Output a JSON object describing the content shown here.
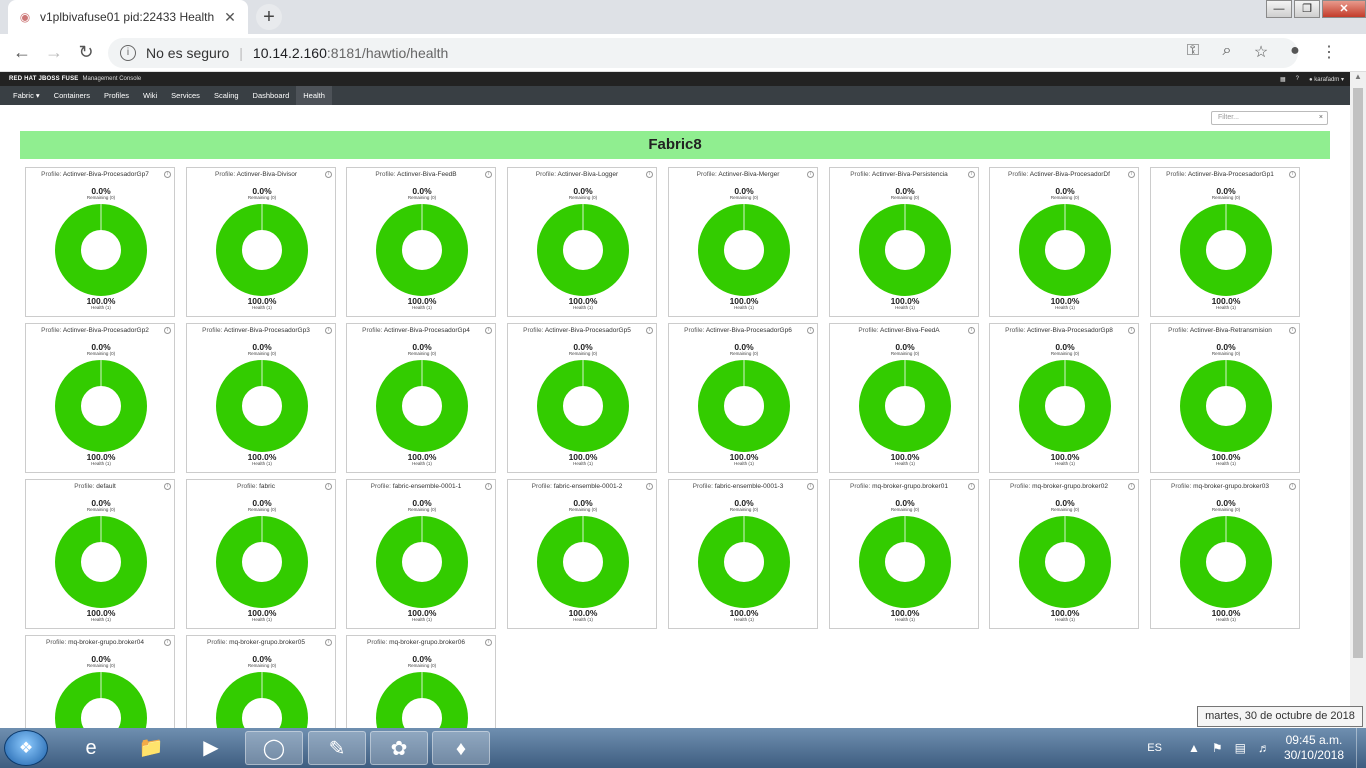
{
  "browser": {
    "tab_title": "v1plbivafuse01 pid:22433 Health",
    "security_label": "No es seguro",
    "url_host": "10.14.2.160",
    "url_rest": ":8181/hawtio/health",
    "colors": {
      "tab_strip": "#dee1e6",
      "omnibox": "#f1f3f4"
    }
  },
  "app": {
    "brand_primary": "RED HAT JBOSS FUSE",
    "brand_secondary": "Management Console",
    "user": "karafadm",
    "nav": [
      {
        "label": "Fabric"
      },
      {
        "label": "Containers"
      },
      {
        "label": "Profiles"
      },
      {
        "label": "Wiki"
      },
      {
        "label": "Services"
      },
      {
        "label": "Scaling"
      },
      {
        "label": "Dashboard"
      },
      {
        "label": "Health"
      }
    ],
    "active_nav": "Health"
  },
  "health": {
    "filter_placeholder": "Filter...",
    "banner_title": "Fabric8",
    "banner_color": "#90ee90",
    "donut_color": "#33cc00",
    "profile_prefix": "Profile:",
    "remaining_label": "Remaining (0)",
    "health_label": "Health (1)",
    "profiles": [
      {
        "name": "Actinver-Biva-ProcesadorGp7",
        "remaining": "0.0%",
        "health": "100.0%"
      },
      {
        "name": "Actinver-Biva-Divisor",
        "remaining": "0.0%",
        "health": "100.0%"
      },
      {
        "name": "Actinver-Biva-FeedB",
        "remaining": "0.0%",
        "health": "100.0%"
      },
      {
        "name": "Actinver-Biva-Logger",
        "remaining": "0.0%",
        "health": "100.0%"
      },
      {
        "name": "Actinver-Biva-Merger",
        "remaining": "0.0%",
        "health": "100.0%"
      },
      {
        "name": "Actinver-Biva-Persistencia",
        "remaining": "0.0%",
        "health": "100.0%"
      },
      {
        "name": "Actinver-Biva-ProcesadorDf",
        "remaining": "0.0%",
        "health": "100.0%"
      },
      {
        "name": "Actinver-Biva-ProcesadorGp1",
        "remaining": "0.0%",
        "health": "100.0%"
      },
      {
        "name": "Actinver-Biva-ProcesadorGp2",
        "remaining": "0.0%",
        "health": "100.0%"
      },
      {
        "name": "Actinver-Biva-ProcesadorGp3",
        "remaining": "0.0%",
        "health": "100.0%"
      },
      {
        "name": "Actinver-Biva-ProcesadorGp4",
        "remaining": "0.0%",
        "health": "100.0%"
      },
      {
        "name": "Actinver-Biva-ProcesadorGp5",
        "remaining": "0.0%",
        "health": "100.0%"
      },
      {
        "name": "Actinver-Biva-ProcesadorGp6",
        "remaining": "0.0%",
        "health": "100.0%"
      },
      {
        "name": "Actinver-Biva-FeedA",
        "remaining": "0.0%",
        "health": "100.0%"
      },
      {
        "name": "Actinver-Biva-ProcesadorGp8",
        "remaining": "0.0%",
        "health": "100.0%"
      },
      {
        "name": "Actinver-Biva-Retransmision",
        "remaining": "0.0%",
        "health": "100.0%"
      },
      {
        "name": "default",
        "remaining": "0.0%",
        "health": "100.0%"
      },
      {
        "name": "fabric",
        "remaining": "0.0%",
        "health": "100.0%"
      },
      {
        "name": "fabric-ensemble-0001-1",
        "remaining": "0.0%",
        "health": "100.0%"
      },
      {
        "name": "fabric-ensemble-0001-2",
        "remaining": "0.0%",
        "health": "100.0%"
      },
      {
        "name": "fabric-ensemble-0001-3",
        "remaining": "0.0%",
        "health": "100.0%"
      },
      {
        "name": "mq-broker-grupo.broker01",
        "remaining": "0.0%",
        "health": "100.0%"
      },
      {
        "name": "mq-broker-grupo.broker02",
        "remaining": "0.0%",
        "health": "100.0%"
      },
      {
        "name": "mq-broker-grupo.broker03",
        "remaining": "0.0%",
        "health": "100.0%"
      },
      {
        "name": "mq-broker-grupo.broker04",
        "remaining": "0.0%",
        "health": "100.0%"
      },
      {
        "name": "mq-broker-grupo.broker05",
        "remaining": "0.0%",
        "health": "100.0%"
      },
      {
        "name": "mq-broker-grupo.broker06",
        "remaining": "0.0%",
        "health": "100.0%"
      }
    ]
  },
  "taskbar": {
    "language": "ES",
    "time": "09:45 a.m.",
    "date": "30/10/2018",
    "tooltip": "martes, 30 de octubre de 2018",
    "apps": [
      {
        "icon": "internet-explorer-icon"
      },
      {
        "icon": "file-explorer-icon"
      },
      {
        "icon": "media-player-icon"
      },
      {
        "icon": "chrome-icon"
      },
      {
        "icon": "notepad-plus-icon"
      },
      {
        "icon": "snail-app-icon"
      },
      {
        "icon": "money-app-icon"
      }
    ]
  }
}
